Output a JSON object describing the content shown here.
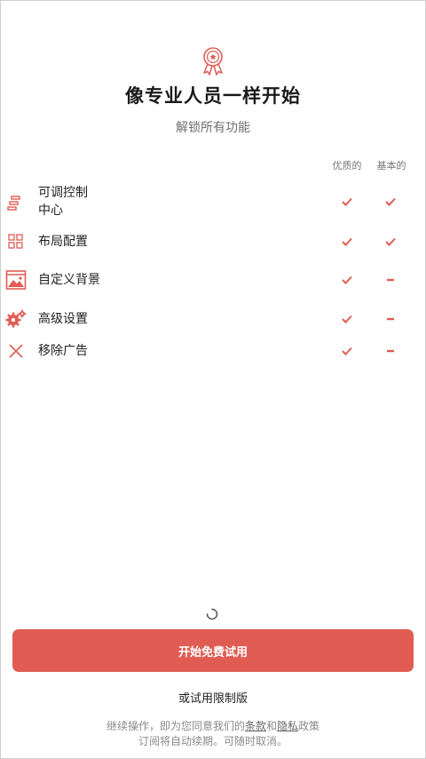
{
  "header": {
    "title": "像专业人员一样开始",
    "subtitle": "解锁所有功能"
  },
  "columns": {
    "premium": "优质的",
    "basic": "基本的"
  },
  "features": [
    {
      "line1": "可调控制",
      "line2": "中心",
      "icon": "sliders-icon",
      "premium": true,
      "basic": true
    },
    {
      "line1": "布局配置",
      "line2": "",
      "icon": "layout-grid-icon",
      "premium": true,
      "basic": true
    },
    {
      "line1": "自定义背景",
      "line2": "",
      "icon": "image-background-icon",
      "premium": true,
      "basic": false
    },
    {
      "line1": "高级设置",
      "line2": "",
      "icon": "gears-icon",
      "premium": true,
      "basic": false
    },
    {
      "line1": "移除广告",
      "line2": "",
      "icon": "close-x-icon",
      "premium": true,
      "basic": false
    }
  ],
  "cta": {
    "label": "开始免费试用"
  },
  "limited": {
    "label": "或试用限制版"
  },
  "terms": {
    "prefix": "继续操作，即为您同意我们的",
    "terms_link": "条款",
    "and": "和",
    "privacy_link": "隐私",
    "suffix": "政策",
    "line2": "订阅将自动续期。可随时取消。"
  },
  "colors": {
    "accent": "#e05c53",
    "text": "#222222",
    "muted": "#777777"
  }
}
